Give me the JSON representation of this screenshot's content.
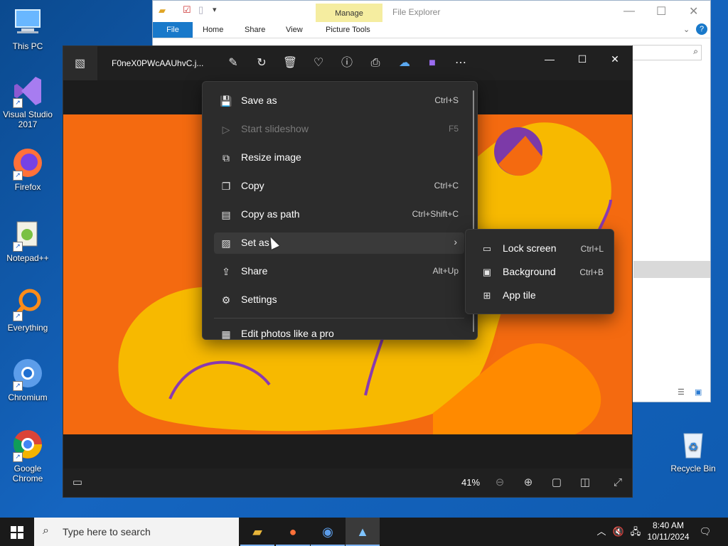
{
  "desktop": {
    "icons": [
      {
        "label": "This PC"
      },
      {
        "label": "Visual Studio 2017"
      },
      {
        "label": "Firefox"
      },
      {
        "label": "Notepad++"
      },
      {
        "label": "Everything"
      },
      {
        "label": "Chromium"
      },
      {
        "label": "Google Chrome"
      }
    ],
    "recycle_bin": "Recycle Bin"
  },
  "explorer": {
    "title": "File Explorer",
    "context_tab_group": "Manage",
    "tabs": [
      "File",
      "Home",
      "Share",
      "View",
      "Picture Tools"
    ]
  },
  "photos": {
    "filename": "F0neX0PWcAAUhvC.j...",
    "zoom": "41%",
    "menu": {
      "items": [
        {
          "label": "Save as",
          "accel": "Ctrl+S",
          "icon": "save-icon"
        },
        {
          "label": "Start slideshow",
          "accel": "F5",
          "icon": "slideshow-icon",
          "disabled": true
        },
        {
          "label": "Resize image",
          "accel": "",
          "icon": "resize-icon"
        },
        {
          "label": "Copy",
          "accel": "Ctrl+C",
          "icon": "copy-icon"
        },
        {
          "label": "Copy as path",
          "accel": "Ctrl+Shift+C",
          "icon": "path-icon"
        },
        {
          "label": "Set as",
          "accel": "",
          "icon": "set-as-icon"
        },
        {
          "label": "Share",
          "accel": "Alt+Up",
          "icon": "share-icon"
        },
        {
          "label": "Settings",
          "accel": "",
          "icon": "gear-icon"
        },
        {
          "label": "Edit photos like a pro",
          "accel": "",
          "icon": "pro-icon"
        }
      ]
    },
    "submenu": {
      "items": [
        {
          "label": "Lock screen",
          "accel": "Ctrl+L",
          "icon": "lock-screen-icon"
        },
        {
          "label": "Background",
          "accel": "Ctrl+B",
          "icon": "background-icon"
        },
        {
          "label": "App tile",
          "accel": "",
          "icon": "app-tile-icon"
        }
      ]
    }
  },
  "taskbar": {
    "search_placeholder": "Type here to search",
    "time": "8:40 AM",
    "date": "10/11/2024"
  },
  "colors": {
    "accent": "#1979ca",
    "image_orange": "#f46a10",
    "image_yellow": "#f7b900",
    "taskbar": "#1a1a1a"
  }
}
